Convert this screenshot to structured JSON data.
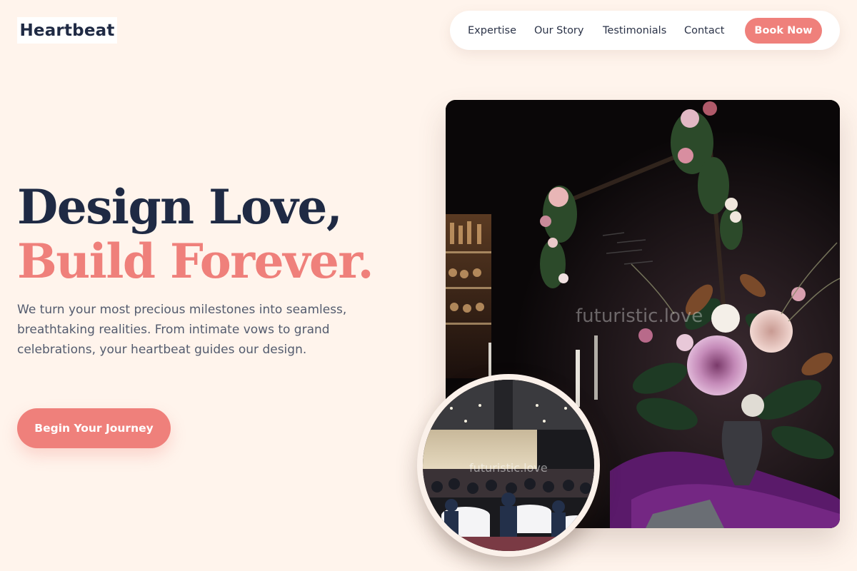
{
  "brand": {
    "name": "Heartbeat"
  },
  "nav": {
    "links": [
      "Expertise",
      "Our Story",
      "Testimonials",
      "Contact"
    ],
    "cta_label": "Book Now"
  },
  "hero": {
    "headline_line1": "Design Love,",
    "headline_line2": "Build Forever.",
    "subtitle": "We turn your most precious milestones into seamless, breathtaking realities. From intimate vows to grand celebrations, your heartbeat guides our design.",
    "cta_label": "Begin Your Journey"
  },
  "images": {
    "main_watermark": "futuristic.love",
    "inset_watermark": "futuristic.love"
  },
  "colors": {
    "background": "#fff4ec",
    "navy": "#1f2a44",
    "coral": "#ef807b",
    "body_text": "#535b6e"
  }
}
